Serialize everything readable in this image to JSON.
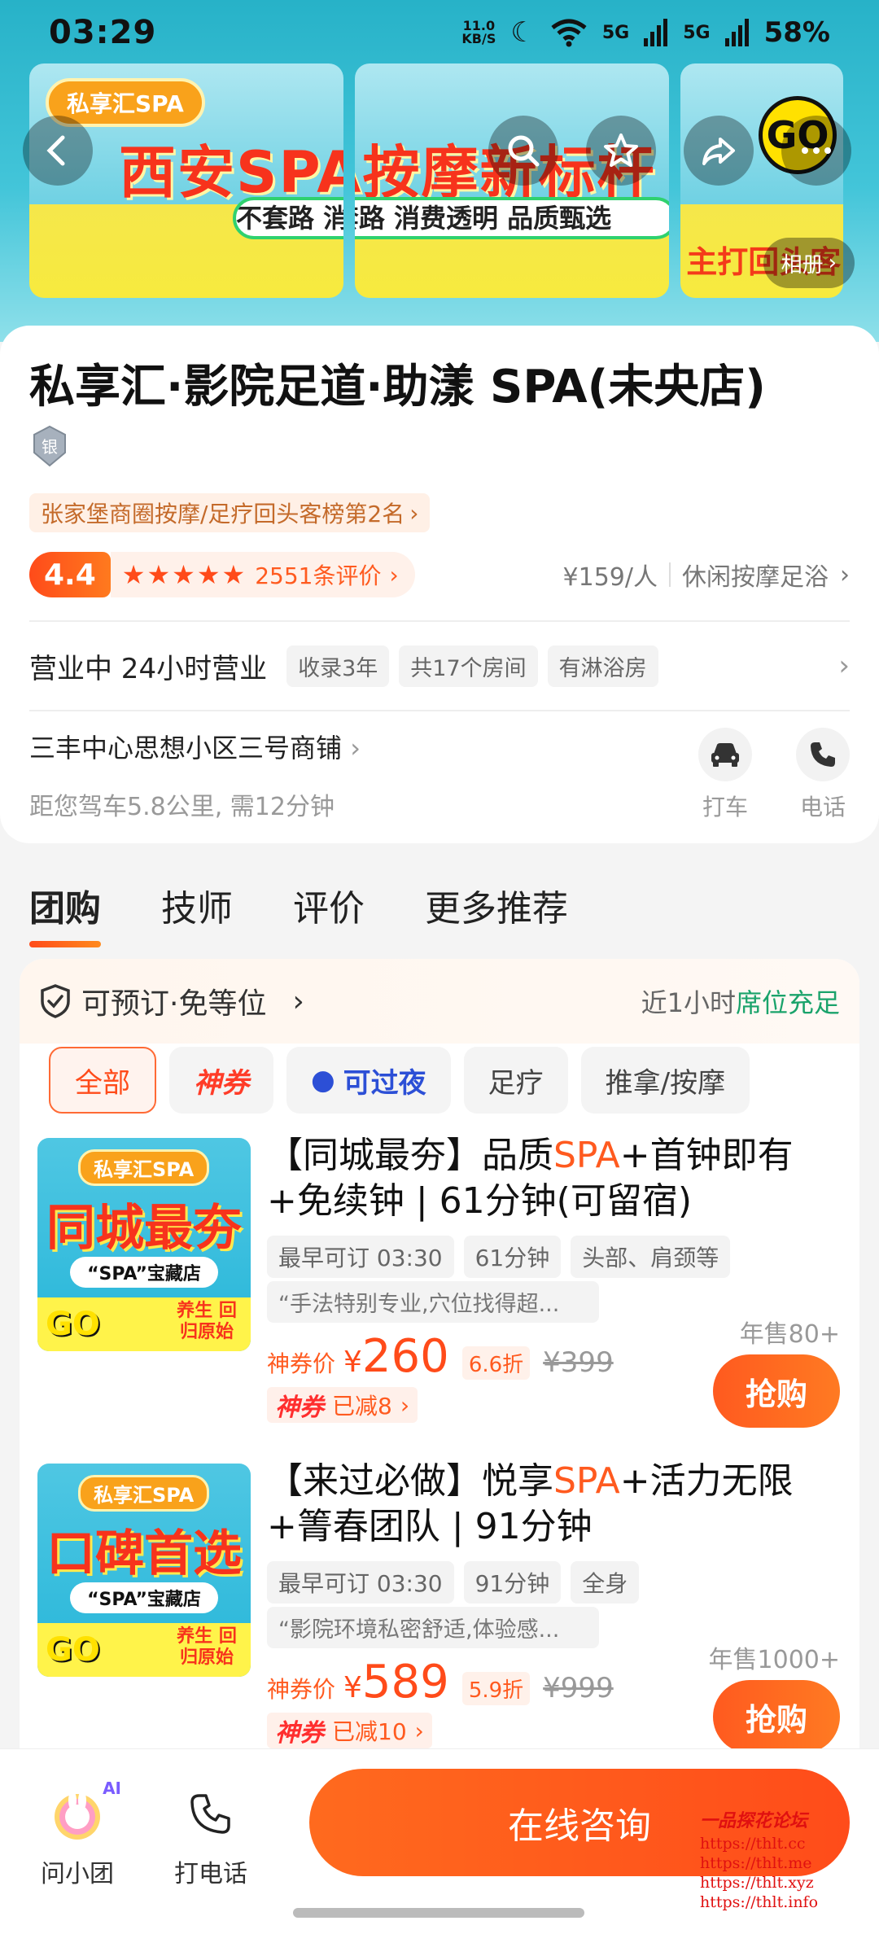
{
  "status_bar": {
    "time": "03:29",
    "net_speed_value": "11.0",
    "net_speed_unit": "KB/S",
    "signal1": "5G",
    "signal2": "5G",
    "battery": "58%"
  },
  "banner": {
    "brand": "私享汇SPA",
    "headline": "西安SPA按摩新标杆",
    "pill": "不套路 消费透明 品质甄选",
    "tagline": "不敷衍 主打回头客",
    "go_badge": "GO",
    "album_label": "相册"
  },
  "shop": {
    "title": "私享汇·影院足道·助漾 SPA(未央店)",
    "level_badge": "银",
    "rank_text": "张家堡商圈按摩/足疗回头客榜第2名",
    "score": "4.4",
    "review_count": "2551条评价",
    "price_per_person": "¥159/人",
    "category": "休闲按摩足浴",
    "status": "营业中 24小时营业",
    "tags": [
      "收录3年",
      "共17个房间",
      "有淋浴房"
    ],
    "address": "三丰中心思想小区三号商铺",
    "distance": "距您驾车5.8公里, 需12分钟",
    "actions": [
      {
        "label": "打车",
        "icon": "car-icon"
      },
      {
        "label": "电话",
        "icon": "phone-icon"
      }
    ]
  },
  "tabs": [
    "团购",
    "技师",
    "评价",
    "更多推荐"
  ],
  "reserve": {
    "left": "可预订·免等位",
    "right_prefix": "近1小时",
    "right_highlight": "席位充足",
    "highlight_color": "#1aa36b"
  },
  "filters": [
    "全部",
    "神券",
    "可过夜",
    "足疗",
    "推拿/按摩"
  ],
  "deals": [
    {
      "thumb": {
        "brand": "私享汇SPA",
        "headline": "同城最夯",
        "sub": "“SPA”宝藏店",
        "go": "GO",
        "slogan": "养生 回归原始"
      },
      "title_pre": "【同城最夯】品质",
      "title_spa": "SPA",
      "title_post": "+首钟即有+免续钟 | 61分钟(可留宿)",
      "tags": [
        "最早可订 03:30",
        "61分钟",
        "头部、肩颈等"
      ],
      "quote": "“手法特别专业,穴位找得超...",
      "price_label": "神券价",
      "yen": "¥",
      "price": "260",
      "discount": "6.6折",
      "original": "¥399",
      "coupon_label": "神券",
      "coupon_text": "已减8",
      "sold": "年售80+",
      "buy": "抢购"
    },
    {
      "thumb": {
        "brand": "私享汇SPA",
        "headline": "口碑首选",
        "sub": "“SPA”宝藏店",
        "go": "GO",
        "slogan": "养生 回归原始"
      },
      "title_pre": "【来过必做】悦享",
      "title_spa": "SPA",
      "title_post": "+活力无限+箐春团队 | 91分钟",
      "tags": [
        "最早可订 03:30",
        "91分钟",
        "全身"
      ],
      "quote": "“影院环境私密舒适,体验感...",
      "price_label": "神券价",
      "yen": "¥",
      "price": "589",
      "discount": "5.9折",
      "original": "¥999",
      "coupon_label": "神券",
      "coupon_text": "已减10",
      "sold": "年售1000+",
      "buy": "抢购"
    }
  ],
  "bottom_bar": {
    "ask": "问小团",
    "ask_badge": "AI",
    "call": "打电话",
    "consult": "在线咨询"
  },
  "watermark": {
    "title": "一品探花论坛",
    "lines": [
      "https://thlt.cc",
      "https://thlt.me",
      "https://thlt.xyz",
      "https://thlt.info"
    ]
  },
  "colors": {
    "accent": "#ff4b1a",
    "teal": "#27b2c8"
  }
}
